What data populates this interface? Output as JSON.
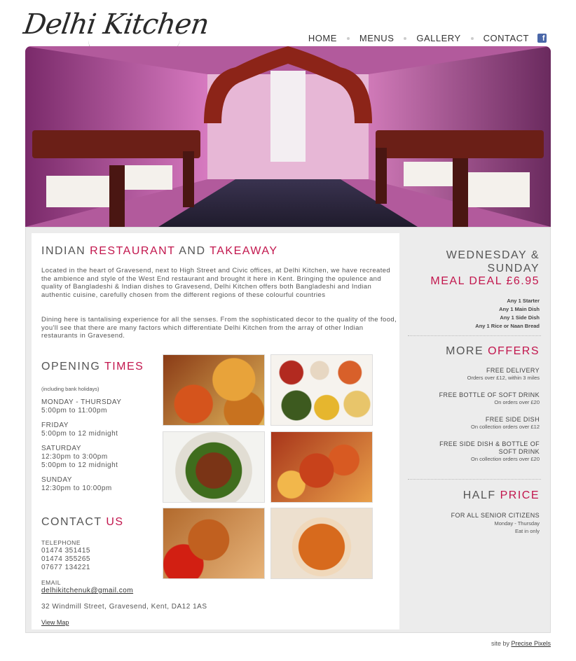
{
  "brand": {
    "name": "Delhi Kitchen"
  },
  "nav": [
    {
      "label": "HOME"
    },
    {
      "label": "MENUS"
    },
    {
      "label": "GALLERY"
    },
    {
      "label": "CONTACT"
    }
  ],
  "icons": {
    "facebook": "facebook-icon"
  },
  "colors": {
    "accent": "#c2164d",
    "text": "#555555",
    "panel": "#ececec"
  },
  "intro": {
    "title_a": "INDIAN ",
    "title_b": "RESTAURANT",
    "title_c": " AND ",
    "title_d": "TAKEAWAY",
    "p1": "Located in the heart of Gravesend, next to High Street and Civic offices, at Delhi Kitchen, we have recreated the ambience and style of the West End restaurant and brought it here in Kent. Bringing the opulence and quality of Bangladeshi & Indian dishes to Gravesend, Delhi Kitchen offers both Bangladeshi and Indian authentic cuisine, carefully chosen from the different regions of these colourful countries",
    "p2": "Dining here is tantalising experience for all the senses. From the sophisticated decor to the quality of the food, you'll see that there are many factors which differentiate Delhi Kitchen from the array of other Indian restaurants in Gravesend."
  },
  "hours": {
    "title_a": "OPENING ",
    "title_b": "TIMES",
    "note": "(including bank holidays)",
    "blocks": [
      {
        "day": "MONDAY - THURSDAY",
        "t1": "5:00pm to 11:00pm",
        "t2": ""
      },
      {
        "day": "FRIDAY",
        "t1": "5:00pm to 12 midnight",
        "t2": ""
      },
      {
        "day": "SATURDAY",
        "t1": "12:30pm to 3:00pm",
        "t2": "5:00pm to 12 midnight"
      },
      {
        "day": "SUNDAY",
        "t1": "12:30pm to 10:00pm",
        "t2": ""
      }
    ]
  },
  "contact": {
    "title_a": "CONTACT",
    "title_b": "US",
    "telephone_label": "TELEPHONE",
    "phones": [
      "01474 351415",
      "01474 355265",
      "07677 134221"
    ],
    "email_label": "EMAIL",
    "email": "delhikitchenuk@gmail.com",
    "address": "32 Windmill Street, Gravesend, Kent, DA12 1AS",
    "map_link": "View Map"
  },
  "deal": {
    "title": "WEDNESDAY & SUNDAY",
    "price": "MEAL DEAL £6.95",
    "items": [
      "Any 1 Starter",
      "Any 1 Main Dish",
      "Any 1 Side Dish",
      "Any 1 Rice or Naan Bread"
    ]
  },
  "more": {
    "title_a": "MORE ",
    "title_b": "OFFERS",
    "offers": [
      {
        "name": "FREE DELIVERY",
        "cond": "Orders over £12, within 3 miles"
      },
      {
        "name": "FREE BOTTLE OF SOFT DRINK",
        "cond": "On orders over £20"
      },
      {
        "name": "FREE SIDE DISH",
        "cond": "On collection orders over £12"
      },
      {
        "name": "FREE SIDE DISH & BOTTLE OF SOFT DRINK",
        "cond": "On collection orders over £20"
      }
    ]
  },
  "half": {
    "title_a": "HALF ",
    "title_b": "PRICE",
    "name": "FOR ALL SENIOR CITIZENS",
    "cond1": "Monday - Thursday",
    "cond2": "Eat in only"
  },
  "footer": {
    "prefix": "site by ",
    "link": "Precise Pixels"
  }
}
